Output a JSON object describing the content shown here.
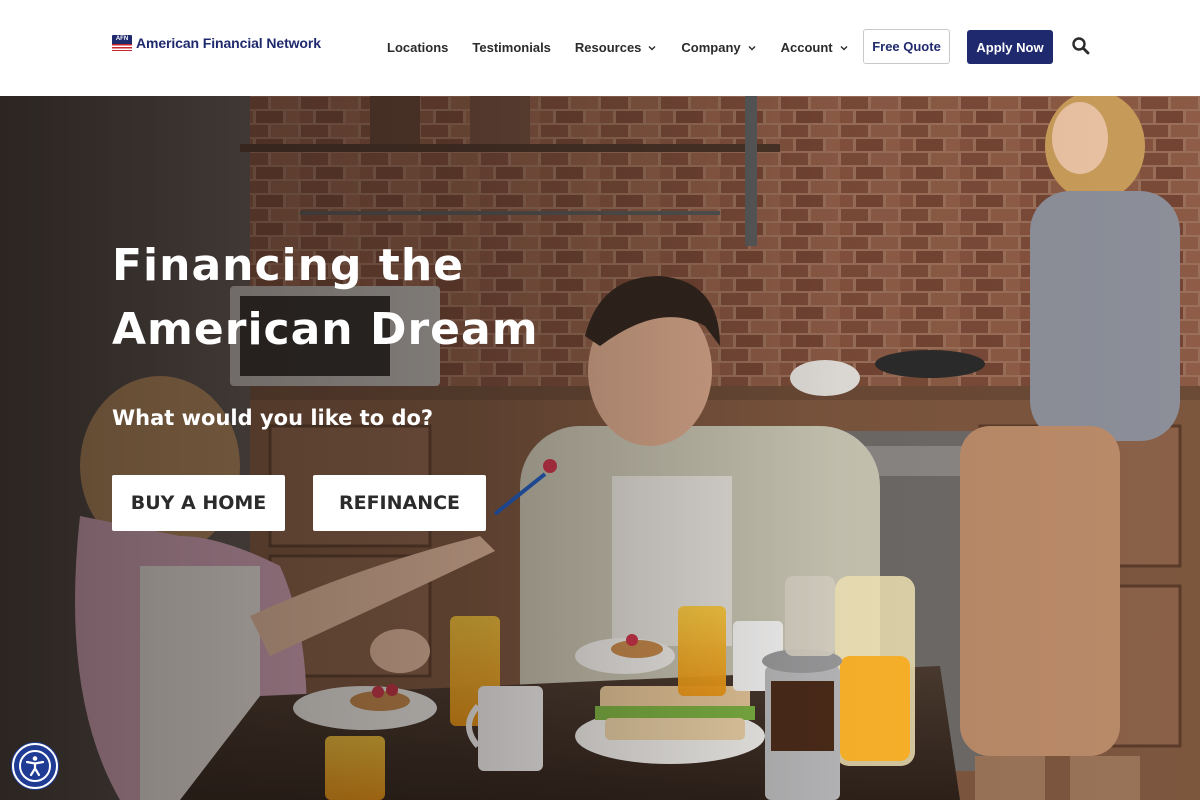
{
  "header": {
    "logo_abbr": "AFN",
    "logo_text": "American Financial Network",
    "nav": [
      {
        "label": "Locations"
      },
      {
        "label": "Testimonials"
      },
      {
        "label": "Resources"
      },
      {
        "label": "Company"
      },
      {
        "label": "Account"
      }
    ],
    "free_quote_label": "Free Quote",
    "apply_now_label": "Apply Now"
  },
  "hero": {
    "title_line1": "Financing the",
    "title_line2": "American Dream",
    "subtitle": "What would you like to do?",
    "buy_home_label": "BUY A HOME",
    "refinance_label": "REFINANCE"
  },
  "icons": {
    "search": "search-icon",
    "chevron": "chevron-down-icon",
    "accessibility": "accessibility-icon"
  },
  "colors": {
    "brand_navy": "#1f2a6e",
    "accessibility_blue": "#1f3b94",
    "flag_red": "#c8262f"
  }
}
